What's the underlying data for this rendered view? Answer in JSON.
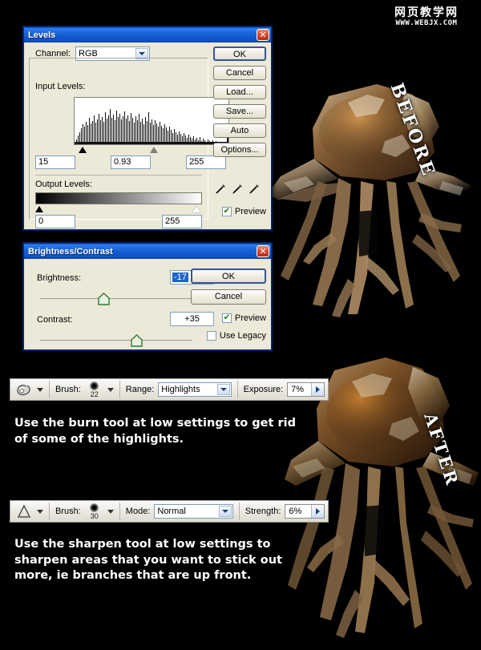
{
  "watermark": {
    "chinese": "网页教学网",
    "url": "WWW.WEBJX.COM"
  },
  "levels_dialog": {
    "title": "Levels",
    "close_label": "✕",
    "channel_label": "Channel:",
    "channel_value": "RGB",
    "input_levels_label": "Input Levels:",
    "input_black": "15",
    "input_gamma": "0.93",
    "input_white": "255",
    "output_levels_label": "Output Levels:",
    "output_black": "0",
    "output_white": "255",
    "buttons": [
      "OK",
      "Cancel",
      "Load...",
      "Save...",
      "Auto",
      "Options..."
    ],
    "preview_label": "Preview",
    "preview_checked": "✔",
    "eyedroppers": [
      "black-point-eyedropper",
      "gray-point-eyedropper",
      "white-point-eyedropper"
    ]
  },
  "brightness_contrast_dialog": {
    "title": "Brightness/Contrast",
    "close_label": "✕",
    "brightness_label": "Brightness:",
    "brightness_value": "-17",
    "contrast_label": "Contrast:",
    "contrast_value": "+35",
    "ok_label": "OK",
    "cancel_label": "Cancel",
    "preview_label": "Preview",
    "preview_checked": "✔",
    "use_legacy_label": "Use Legacy",
    "use_legacy_checked": ""
  },
  "burn_tool_bar": {
    "tool_icon": "burn-tool-icon",
    "brush_label": "Brush:",
    "brush_size": "22",
    "range_label": "Range:",
    "range_value": "Highlights",
    "exposure_label": "Exposure:",
    "exposure_value": "7%"
  },
  "sharpen_tool_bar": {
    "tool_icon": "sharpen-tool-icon",
    "brush_label": "Brush:",
    "brush_size": "30",
    "mode_label": "Mode:",
    "mode_value": "Normal",
    "strength_label": "Strength:",
    "strength_value": "6%"
  },
  "captions": {
    "burn": "Use the burn tool at low settings to get rid of some of the highlights.",
    "sharpen": "Use the sharpen tool at low settings to sharpen areas that you want to stick out more, ie branches that are up front."
  },
  "images": {
    "before_label": "BEFORE",
    "after_label": "AFTER"
  },
  "colors": {
    "title_bar_blue": "#0b55c4",
    "dialog_face": "#ece9d8",
    "dialog_border": "#0a246a",
    "close_red": "#d8442a",
    "background": "#000000",
    "caption_text": "#ffffff"
  }
}
